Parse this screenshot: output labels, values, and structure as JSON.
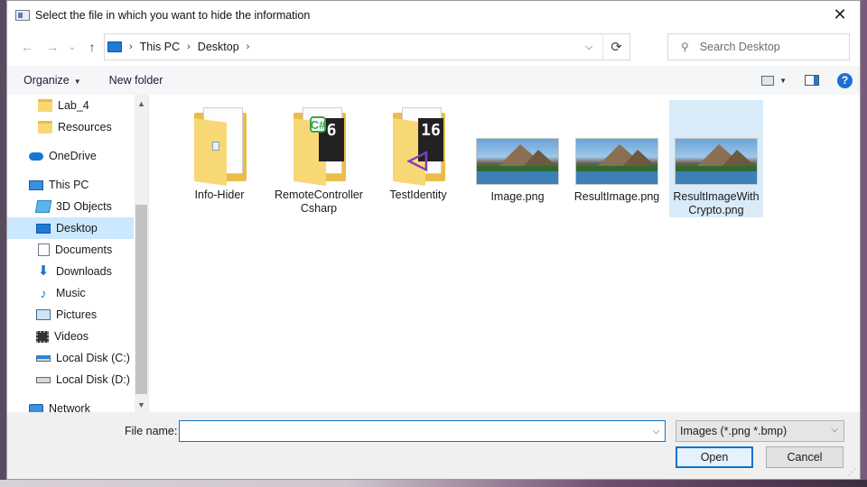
{
  "window": {
    "title": "Select the file in which you want to hide the information",
    "close_glyph": "✕"
  },
  "address": {
    "crumbs": [
      "This PC",
      "Desktop"
    ],
    "dropdown_glyph": "⌵",
    "refresh_glyph": "⟳"
  },
  "search": {
    "placeholder": "Search Desktop"
  },
  "toolbar": {
    "organize_label": "Organize",
    "new_folder_label": "New folder"
  },
  "sidebar": {
    "items": [
      {
        "label": "Lab_4",
        "icon": "folder-icon"
      },
      {
        "label": "Resources",
        "icon": "folder-icon"
      },
      {
        "label": "OneDrive",
        "icon": "cloud-icon"
      },
      {
        "label": "This PC",
        "icon": "computer-icon"
      },
      {
        "label": "3D Objects",
        "icon": "cube-icon"
      },
      {
        "label": "Desktop",
        "icon": "desktop-icon",
        "selected": true
      },
      {
        "label": "Documents",
        "icon": "document-icon"
      },
      {
        "label": "Downloads",
        "icon": "download-icon"
      },
      {
        "label": "Music",
        "icon": "music-icon"
      },
      {
        "label": "Pictures",
        "icon": "pictures-icon"
      },
      {
        "label": "Videos",
        "icon": "video-icon"
      },
      {
        "label": "Local Disk (C:)",
        "icon": "disk-icon"
      },
      {
        "label": "Local Disk (D:)",
        "icon": "disk-icon"
      },
      {
        "label": "Network",
        "icon": "network-icon"
      }
    ]
  },
  "files": [
    {
      "name": "Info-Hider",
      "type": "folder"
    },
    {
      "name": "RemoteControllerCsharp",
      "type": "folder",
      "badge": "6",
      "mark": "C#"
    },
    {
      "name": "TestIdentity",
      "type": "folder",
      "badge": "16"
    },
    {
      "name": "Image.png",
      "type": "image"
    },
    {
      "name": "ResultImage.png",
      "type": "image"
    },
    {
      "name": "ResultImageWithCrypto.png",
      "type": "image",
      "selected": true
    }
  ],
  "bottom": {
    "file_name_label": "File name:",
    "file_name_value": "",
    "filter_value": "Images (*.png *.bmp)",
    "open_label": "Open",
    "cancel_label": "Cancel"
  },
  "colors": {
    "accent": "#0f72c9",
    "selection": "#cce8ff",
    "folder": "#f8d775"
  }
}
